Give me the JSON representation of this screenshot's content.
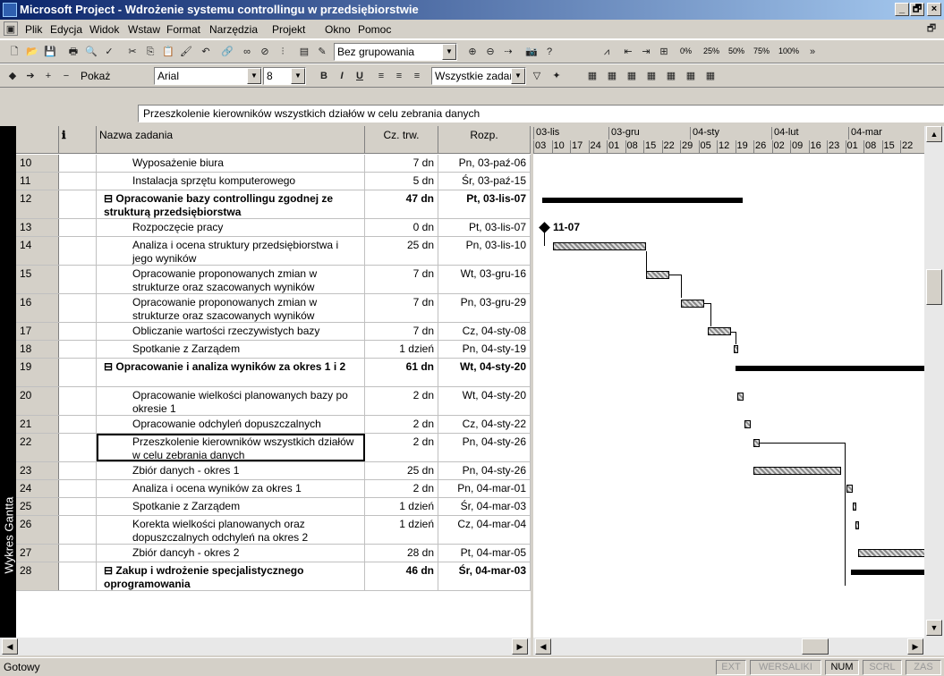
{
  "window": {
    "title": "Microsoft Project - Wdrożenie systemu controllingu  w przedsiębiorstwie",
    "min": "_",
    "max": "🗗",
    "close": "×"
  },
  "menu": [
    "Plik",
    "Edycja",
    "Widok",
    "Wstaw",
    "Format",
    "Narzędzia",
    "Projekt",
    "Okno",
    "Pomoc"
  ],
  "toolbar1": {
    "grouping": "Bez grupowania",
    "zoom_labels": [
      "0%",
      "25%",
      "50%",
      "75%",
      "100%"
    ]
  },
  "toolbar2": {
    "show": "Pokaż",
    "font": "Arial",
    "size": "8",
    "bold": "B",
    "italic": "I",
    "underline": "U",
    "filter": "Wszystkie zadania"
  },
  "entry": {
    "value": "Przeszkolenie kierowników wszystkich działów w celu zebrania danych"
  },
  "view_bar": {
    "label": "Wykres Gantta"
  },
  "table": {
    "headers": {
      "id": "",
      "info": "ℹ",
      "name": "Nazwa zadania",
      "duration": "Cz. trw.",
      "start": "Rozp."
    },
    "rows": [
      {
        "id": "10",
        "name": "Wyposażenie biura",
        "duration": "7 dn",
        "start": "Pn, 03-paź-06",
        "summary": false
      },
      {
        "id": "11",
        "name": "Instalacja sprzętu komputerowego",
        "duration": "5 dn",
        "start": "Śr, 03-paź-15",
        "summary": false
      },
      {
        "id": "12",
        "name": "⊟ Opracowanie bazy controllingu zgodnej ze strukturą przedsiębiorstwa",
        "duration": "47 dn",
        "start": "Pt, 03-lis-07",
        "summary": true
      },
      {
        "id": "13",
        "name": "Rozpoczęcie pracy",
        "duration": "0 dn",
        "start": "Pt, 03-lis-07",
        "summary": false
      },
      {
        "id": "14",
        "name": "Analiza i ocena struktury przedsiębiorstwa i jego wyników",
        "duration": "25 dn",
        "start": "Pn, 03-lis-10",
        "summary": false
      },
      {
        "id": "15",
        "name": "Opracowanie proponowanych zmian w strukturze oraz szacowanych wyników",
        "duration": "7 dn",
        "start": "Wt, 03-gru-16",
        "summary": false
      },
      {
        "id": "16",
        "name": "Opracowanie proponowanych zmian w strukturze oraz szacowanych wyników",
        "duration": "7 dn",
        "start": "Pn, 03-gru-29",
        "summary": false
      },
      {
        "id": "17",
        "name": "Obliczanie wartości rzeczywistych bazy",
        "duration": "7 dn",
        "start": "Cz, 04-sty-08",
        "summary": false
      },
      {
        "id": "18",
        "name": "Spotkanie z Zarządem",
        "duration": "1 dzień",
        "start": "Pn, 04-sty-19",
        "summary": false
      },
      {
        "id": "19",
        "name": "⊟ Opracowanie i analiza wyników za okres 1 i 2",
        "duration": "61 dn",
        "start": "Wt, 04-sty-20",
        "summary": true
      },
      {
        "id": "20",
        "name": "Opracowanie wielkości planowanych bazy po okresie 1",
        "duration": "2 dn",
        "start": "Wt, 04-sty-20",
        "summary": false
      },
      {
        "id": "21",
        "name": "Opracowanie odchyleń dopuszczalnych",
        "duration": "2 dn",
        "start": "Cz, 04-sty-22",
        "summary": false
      },
      {
        "id": "22",
        "name": "Przeszkolenie kierowników wszystkich działów w celu zebrania danych",
        "duration": "2 dn",
        "start": "Pn, 04-sty-26",
        "summary": false
      },
      {
        "id": "23",
        "name": "Zbiór danych - okres 1",
        "duration": "25 dn",
        "start": "Pn, 04-sty-26",
        "summary": false
      },
      {
        "id": "24",
        "name": "Analiza i ocena wyników za okres 1",
        "duration": "2 dn",
        "start": "Pn, 04-mar-01",
        "summary": false
      },
      {
        "id": "25",
        "name": "Spotkanie z Zarządem",
        "duration": "1 dzień",
        "start": "Śr, 04-mar-03",
        "summary": false
      },
      {
        "id": "26",
        "name": "Korekta wielkości planowanych oraz dopuszczalnych odchyleń na okres 2",
        "duration": "1 dzień",
        "start": "Cz, 04-mar-04",
        "summary": false
      },
      {
        "id": "27",
        "name": "Zbiór dancyh  - okres 2",
        "duration": "28 dn",
        "start": "Pt, 04-mar-05",
        "summary": false
      },
      {
        "id": "28",
        "name": "⊟ Zakup i wdrożenie specjalistycznego oprogramowania",
        "duration": "46 dn",
        "start": "Śr, 04-mar-03",
        "summary": true
      }
    ]
  },
  "gantt": {
    "months": [
      "03-lis",
      "03-gru",
      "04-sty",
      "04-lut",
      "04-mar"
    ],
    "days": [
      "03",
      "10",
      "17",
      "24",
      "01",
      "08",
      "15",
      "22",
      "29",
      "05",
      "12",
      "19",
      "26",
      "02",
      "09",
      "16",
      "23",
      "01",
      "08",
      "15",
      "22"
    ],
    "milestone_label": "11-07"
  },
  "status": {
    "ready": "Gotowy",
    "ext": "EXT",
    "caps": "WERSALIKI",
    "num": "NUM",
    "scrl": "SCRL",
    "ovr": "ZAS"
  }
}
